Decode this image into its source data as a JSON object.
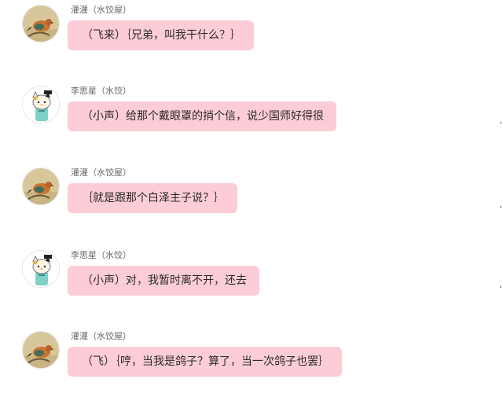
{
  "messages": [
    {
      "sender": "灌灌（水饺屋）",
      "text": "（飞来）｛兄弟，叫我干什么？｝",
      "avatar": "bird-painting-avatar"
    },
    {
      "sender": "李思星（水饺）",
      "text": "（小声）给那个戴眼罩的捎个信，说少国师好得很",
      "avatar": "cartoon-cat-avatar"
    },
    {
      "sender": "灌灌（水饺屋）",
      "text": "｛就是跟那个白泽主子说？｝",
      "avatar": "bird-painting-avatar"
    },
    {
      "sender": "李思星（水饺）",
      "text": "（小声）对，我暂时离不开，还去",
      "avatar": "cartoon-cat-avatar"
    },
    {
      "sender": "灌灌（水饺屋）",
      "text": "（飞）｛哼，当我是鸽子？算了，当一次鸽子也罢｝",
      "avatar": "bird-painting-avatar"
    }
  ],
  "colors": {
    "bubble": "#fccdd6",
    "text": "#2a2a2a",
    "sender": "#666666"
  }
}
